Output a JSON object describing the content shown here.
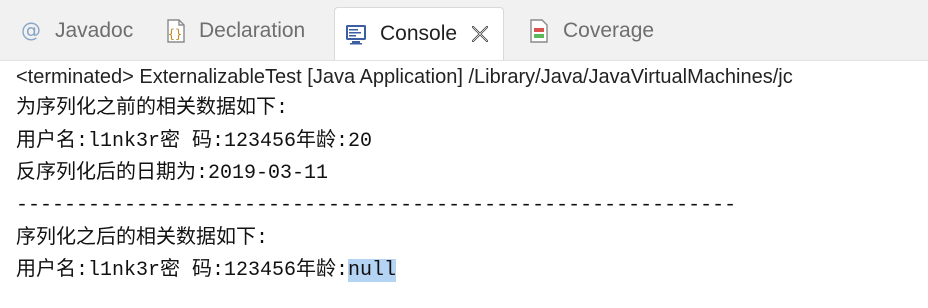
{
  "tabs": [
    {
      "label": "Javadoc",
      "icon": "at-icon"
    },
    {
      "label": "Declaration",
      "icon": "declaration-icon"
    },
    {
      "label": "Console",
      "icon": "console-icon",
      "active": true
    },
    {
      "label": "Coverage",
      "icon": "coverage-icon"
    }
  ],
  "status": "<terminated> ExternalizableTest [Java Application] /Library/Java/JavaVirtualMachines/jc",
  "console": {
    "line1": "为序列化之前的相关数据如下:",
    "line2": "用户名:l1nk3r密 码:123456年龄:20",
    "line3": "反序列化后的日期为:2019-03-11",
    "line4": "------------------------------------------------------------",
    "line5": "序列化之后的相关数据如下:",
    "line6_prefix": "用户名:l1nk3r密 码:123456年龄:",
    "line6_selected": "null"
  },
  "colors": {
    "selection": "#b5d3f3",
    "tabbar_bg": "#f1f1f1"
  }
}
